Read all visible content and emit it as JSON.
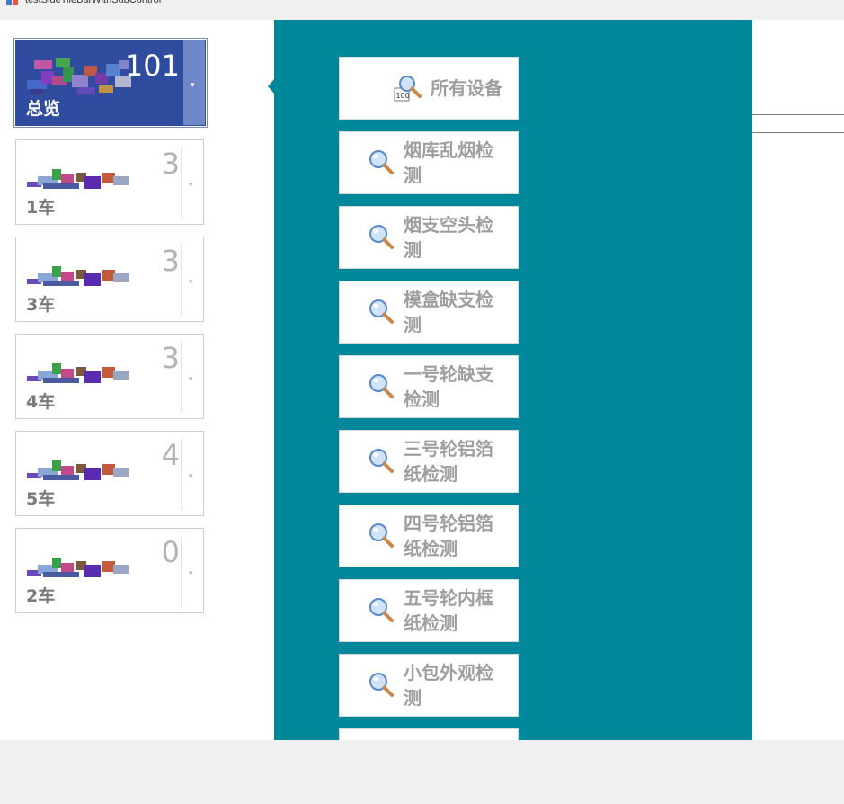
{
  "window": {
    "title": "testSideTileBarWithSubControl"
  },
  "colors": {
    "accent": "#2f4c9e",
    "teal": "#00879a",
    "label_gray": "#9e9e9e"
  },
  "tiles": [
    {
      "name": "总览",
      "count": "101",
      "selected": true
    },
    {
      "name": "1车",
      "count": "3"
    },
    {
      "name": "3车",
      "count": "3"
    },
    {
      "name": "4车",
      "count": "3"
    },
    {
      "name": "5车",
      "count": "4"
    },
    {
      "name": "2车",
      "count": "0"
    }
  ],
  "detections": [
    {
      "label": "所有设备",
      "icon": "search-100-icon"
    },
    {
      "label": "烟库乱烟检测",
      "icon": "magnifier-icon"
    },
    {
      "label": "烟支空头检测",
      "icon": "magnifier-icon"
    },
    {
      "label": "模盒缺支检测",
      "icon": "magnifier-icon"
    },
    {
      "label": "一号轮缺支检测",
      "icon": "magnifier-icon"
    },
    {
      "label": "三号轮铝箔纸检测",
      "icon": "magnifier-icon"
    },
    {
      "label": "四号轮铝箔纸检测",
      "icon": "magnifier-icon"
    },
    {
      "label": "五号轮内框纸检测",
      "icon": "magnifier-icon"
    },
    {
      "label": "小包外观检测",
      "icon": "magnifier-icon"
    },
    {
      "label": "",
      "icon": "magnifier-icon"
    }
  ]
}
